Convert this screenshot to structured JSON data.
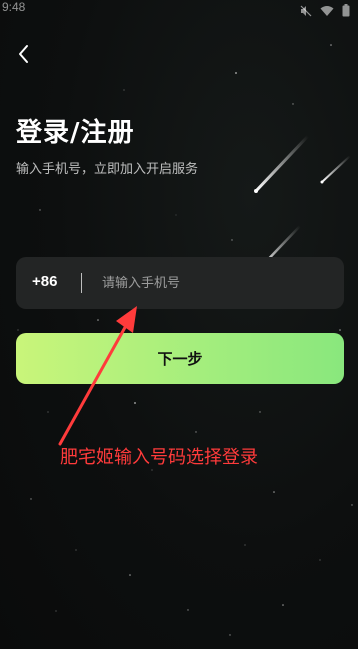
{
  "status_bar": {
    "time": "9:48",
    "icons": [
      "mute-icon",
      "wifi-icon",
      "battery-icon"
    ]
  },
  "header": {
    "back_icon": "chevron-left-icon"
  },
  "login": {
    "title": "登录/注册",
    "subtitle": "输入手机号，立即加入开启服务",
    "country_code": "+86",
    "phone_value": "",
    "phone_placeholder": "请输入手机号",
    "next_label": "下一步"
  },
  "annotation": {
    "text": "肥宅姬输入号码选择登录",
    "color": "#ff3b3b"
  },
  "theme": {
    "background": "#0e1010",
    "input_background": "#232525",
    "button_gradient_start": "#c9f57a",
    "button_gradient_end": "#89e77d"
  }
}
